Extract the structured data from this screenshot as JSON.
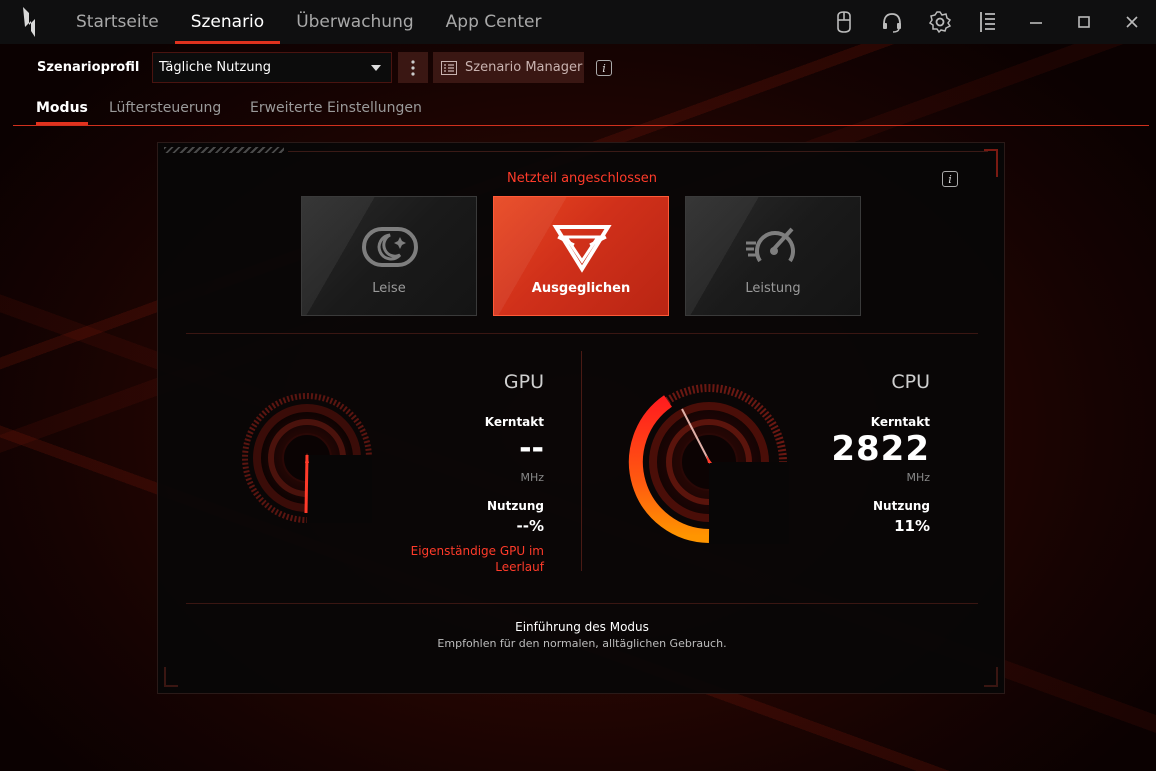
{
  "nav": {
    "tabs": [
      {
        "label": "Startseite"
      },
      {
        "label": "Szenario"
      },
      {
        "label": "Überwachung"
      },
      {
        "label": "App Center"
      }
    ],
    "active_index": 1
  },
  "window_controls": {
    "icons": [
      "mouse-icon",
      "headset-icon",
      "settings-icon",
      "list-icon",
      "minimize-icon",
      "maximize-icon",
      "close-icon"
    ]
  },
  "profile": {
    "label": "Szenarioprofil",
    "selected": "Tägliche Nutzung",
    "manager_label": "Szenario Manager"
  },
  "subtabs": {
    "items": [
      {
        "label": "Modus"
      },
      {
        "label": "Lüftersteuerung"
      },
      {
        "label": "Erweiterte Einstellungen"
      }
    ],
    "active_index": 0
  },
  "mode_panel": {
    "power_status": "Netzteil angeschlossen",
    "modes": [
      {
        "label": "Leise",
        "icon": "moon-icon"
      },
      {
        "label": "Ausgeglichen",
        "icon": "balanced-icon"
      },
      {
        "label": "Leistung",
        "icon": "speedometer-icon"
      }
    ],
    "active_mode_index": 1
  },
  "gpu": {
    "title": "GPU",
    "clock_label": "Kerntakt",
    "clock_value": "--",
    "clock_unit": "MHz",
    "usage_label": "Nutzung",
    "usage_value": "--%",
    "warning": "Eigenständige GPU im Leerlauf",
    "usage_fraction": 0.0
  },
  "cpu": {
    "title": "CPU",
    "clock_label": "Kerntakt",
    "clock_value": "2822",
    "clock_unit": "MHz",
    "usage_label": "Nutzung",
    "usage_value": "11%",
    "usage_fraction": 0.11
  },
  "intro": {
    "title": "Einführung des Modus",
    "description": "Empfohlen für den normalen, alltäglichen Gebrauch."
  },
  "colors": {
    "accent": "#e0321e",
    "warning": "#ff3b2a",
    "gauge_orange": "#ff8a00",
    "gauge_red": "#ff1e1e"
  }
}
